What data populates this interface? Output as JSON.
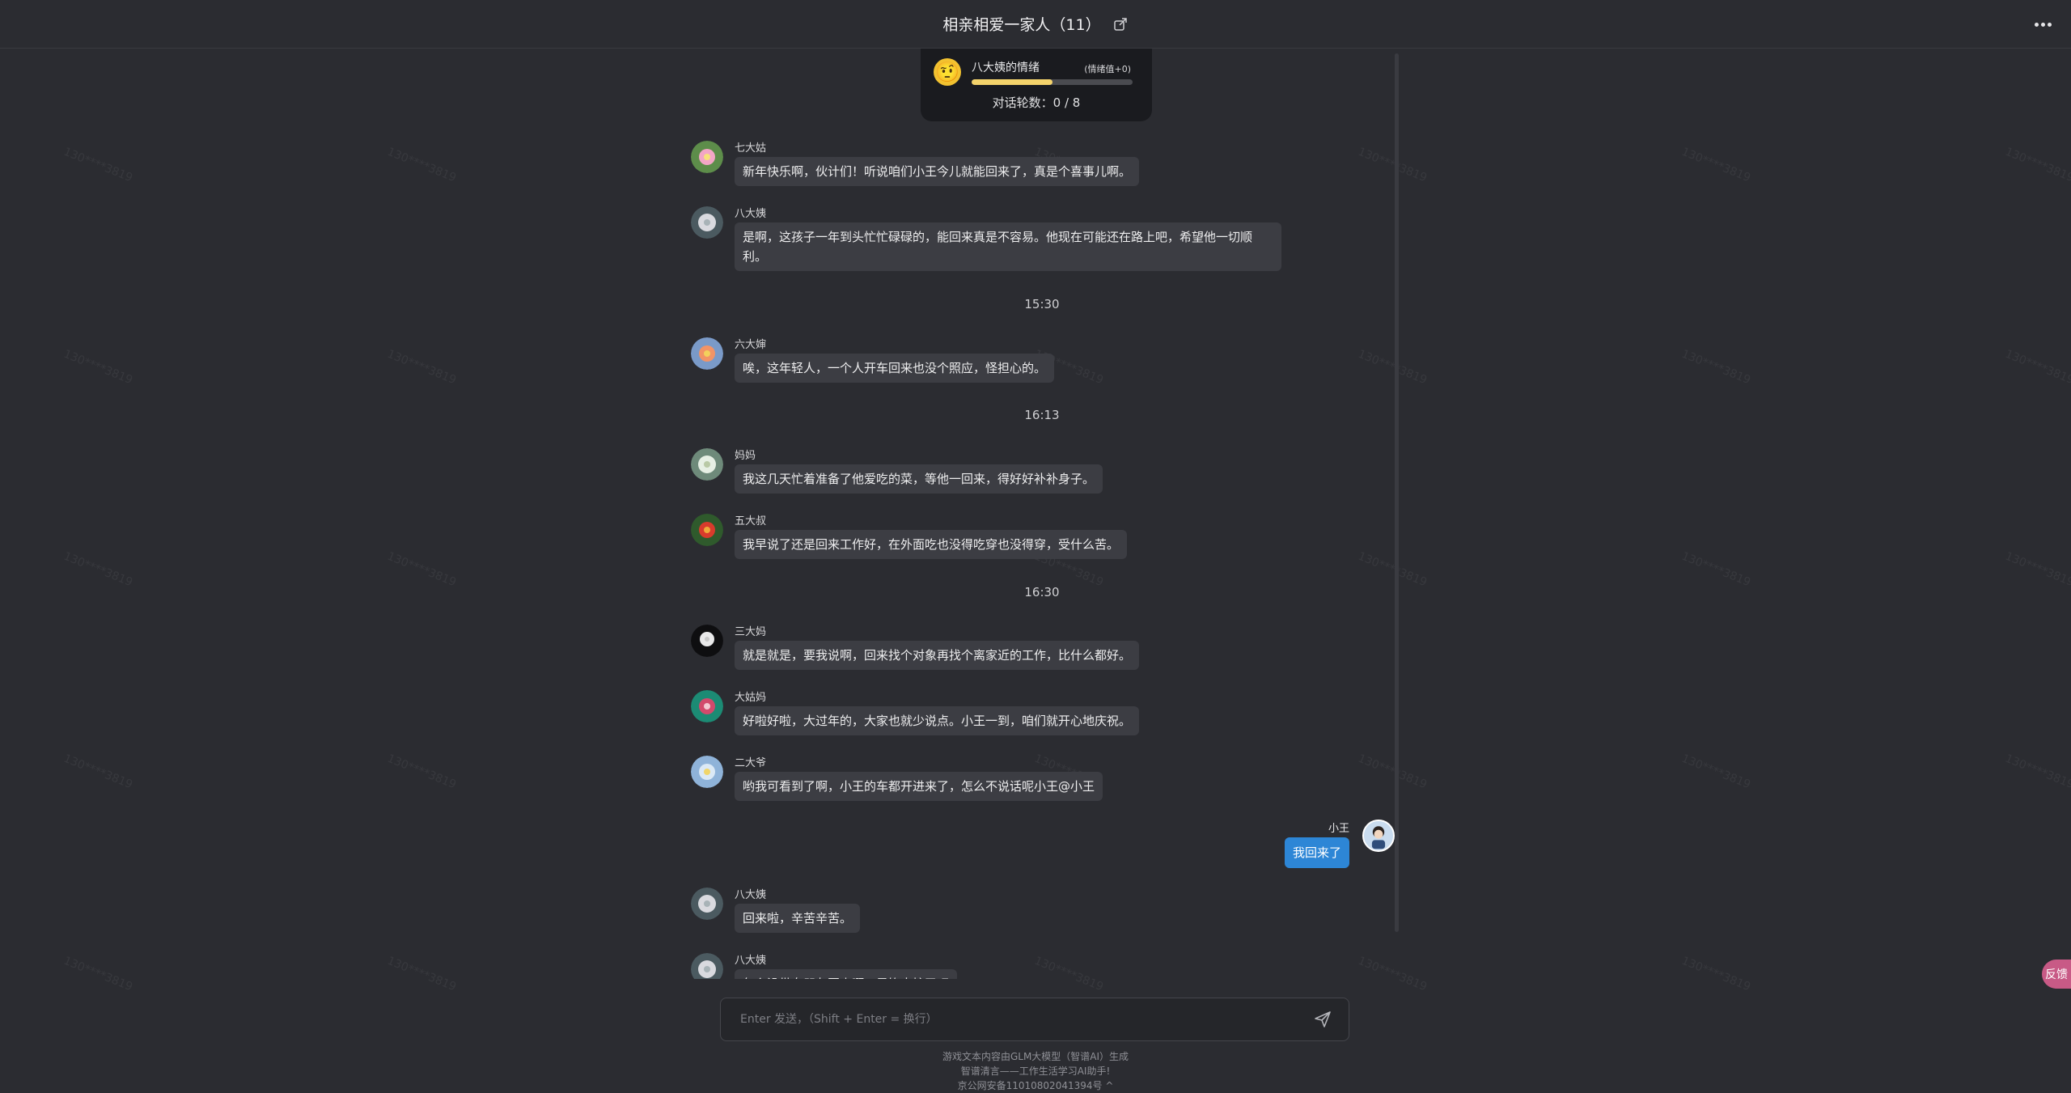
{
  "header": {
    "title": "相亲相爱一家人（11）"
  },
  "mood": {
    "character": "八大姨的情绪",
    "value_label": "(情绪值+0)",
    "emoji": "🤨",
    "level": 0.5,
    "rounds_label": "对话轮数：0 / 8"
  },
  "messages": [
    {
      "sender": "七大姑",
      "text": "新年快乐啊，伙计们！听说咱们小王今儿就能回来了，真是个喜事儿啊。"
    },
    {
      "sender": "八大姨",
      "text": "是啊，这孩子一年到头忙忙碌碌的，能回来真是不容易。他现在可能还在路上吧，希望他一切顺利。"
    },
    {
      "sender": "六大婶",
      "text": "唉，这年轻人，一个人开车回来也没个照应，怪担心的。"
    },
    {
      "sender": "妈妈",
      "text": "我这几天忙着准备了他爱吃的菜，等他一回来，得好好补补身子。"
    },
    {
      "sender": "五大叔",
      "text": "我早说了还是回来工作好，在外面吃也没得吃穿也没得穿，受什么苦。"
    },
    {
      "sender": "三大妈",
      "text": "就是就是，要我说啊，回来找个对象再找个离家近的工作，比什么都好。"
    },
    {
      "sender": "大姑妈",
      "text": "好啦好啦，大过年的，大家也就少说点。小王一到，咱们就开心地庆祝。"
    },
    {
      "sender": "二大爷",
      "text": "哟我可看到了啊，小王的车都开进来了，怎么不说话呢小王@小王"
    },
    {
      "sender": "八大姨",
      "text": "回来啦，辛苦辛苦。"
    },
    {
      "sender": "八大姨",
      "text": "怎么没带女朋友回来啊，是饰太忙了吧"
    }
  ],
  "times": [
    "15:30",
    "16:13",
    "16:30"
  ],
  "self_message": {
    "sender": "小王",
    "text": "我回来了"
  },
  "input": {
    "placeholder": "Enter 发送，（Shift + Enter = 换行）"
  },
  "footer": {
    "line1": "游戏文本内容由GLM大模型（智谱AI）生成",
    "line2": "智谱清言——工作生活学习AI助手!",
    "line3": "京公网安备11010802041394号",
    "chevron": "^"
  },
  "side_tab": "反馈",
  "watermark_text": "130****3819",
  "icons": {
    "share": "share-icon",
    "more": "more-icon",
    "send": "send-icon"
  },
  "colors": {
    "background": "#2b2c31",
    "bubble": "#3c3d43",
    "self_bubble": "#2d86d6",
    "mood_bar": "#f4d36b",
    "side_tab": "#c85a86"
  }
}
